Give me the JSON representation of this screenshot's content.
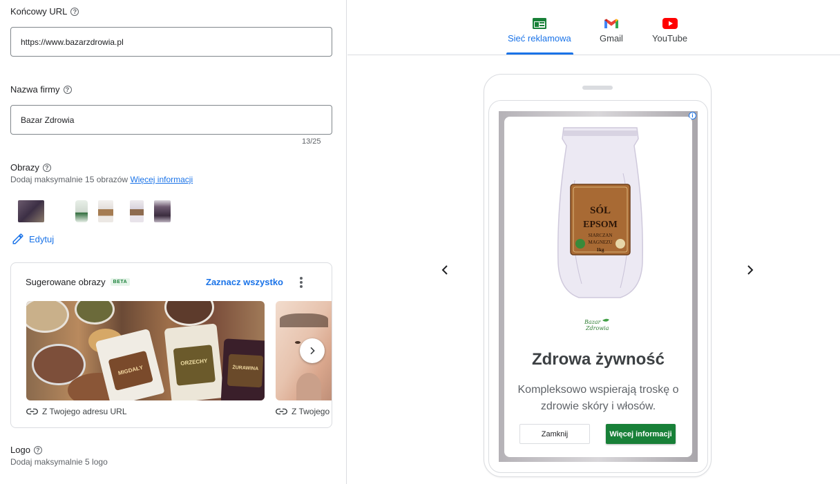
{
  "final_url": {
    "label": "Końcowy URL",
    "value": "https://www.bazarzdrowia.pl"
  },
  "business_name": {
    "label": "Nazwa firmy",
    "value": "Bazar Zdrowia",
    "counter": "13/25"
  },
  "images": {
    "label": "Obrazy",
    "hint": "Dodaj maksymalnie 15 obrazów",
    "more_link": "Więcej informacji",
    "edit_label": "Edytuj"
  },
  "suggested": {
    "title": "Sugerowane obrazy",
    "beta": "BETA",
    "select_all": "Zaznacz wszystko",
    "items": [
      {
        "source": "Z Twojego adresu URL",
        "bag_labels": [
          "MIGDAŁY",
          "ORZECHY",
          "ŻURAWINA"
        ]
      },
      {
        "source": "Z Twojego adresu URL"
      }
    ]
  },
  "logo": {
    "label": "Logo",
    "hint": "Dodaj maksymalnie 5 logo"
  },
  "preview": {
    "tabs": [
      {
        "label": "Sieć reklamowa",
        "icon": "display-network-icon",
        "active": true
      },
      {
        "label": "Gmail",
        "icon": "gmail-icon",
        "active": false
      },
      {
        "label": "YouTube",
        "icon": "youtube-icon",
        "active": false
      }
    ],
    "ad": {
      "headline": "Zdrowa żywność",
      "description": "Kompleksowo wspierają troskę o zdrowie skóry i włosów.",
      "close_label": "Zamknij",
      "cta_label": "Więcej informacji",
      "product_label": [
        "SÓL",
        "EPSOM",
        "SIARCZAN",
        "MAGNEZU",
        "1kg"
      ],
      "brand_mark": "Bazar Zdrowia"
    }
  },
  "colors": {
    "accent": "#1a73e8",
    "cta": "#188038",
    "border": "#dadce0"
  }
}
